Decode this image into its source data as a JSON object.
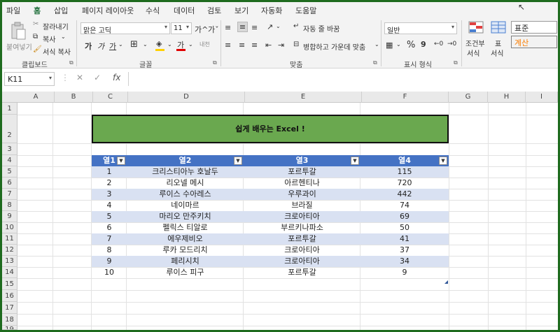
{
  "menu": {
    "tabs": [
      "파일",
      "홈",
      "삽입",
      "페이지 레이아웃",
      "수식",
      "데이터",
      "검토",
      "보기",
      "자동화",
      "도움말"
    ],
    "active_tab": "홈"
  },
  "ribbon": {
    "clipboard": {
      "paste": "붙여넣기",
      "cut": "잘라내기",
      "copy": "복사",
      "format_painter": "서식 복사",
      "label": "클립보드"
    },
    "font": {
      "family": "맑은 고딕",
      "size": "11",
      "grow": "가^",
      "shrink": "가ˇ",
      "bold": "가",
      "italic": "가",
      "underline": "가",
      "phonetic": "내천",
      "label": "글꼴"
    },
    "alignment": {
      "wrap_text": "자동 줄 바꿈",
      "merge_center": "병합하고 가운데 맞춤",
      "label": "맞춤"
    },
    "number": {
      "format": "일반",
      "percent": "%",
      "comma": "9",
      "label": "표시 형식"
    },
    "styles": {
      "conditional": "조건부",
      "conditional2": "서식",
      "table": "표",
      "table2": "서식",
      "normal": "표준",
      "calc": "계산"
    }
  },
  "formula_bar": {
    "name_box": "K11",
    "fx": "fx",
    "value": ""
  },
  "sheet": {
    "columns": [
      "A",
      "B",
      "C",
      "D",
      "E",
      "F",
      "G",
      "H",
      "I"
    ],
    "rows": [
      "1",
      "2",
      "3",
      "4",
      "5",
      "6",
      "7",
      "8",
      "9",
      "10",
      "11",
      "12",
      "13",
      "14",
      "15",
      "16",
      "17",
      "18",
      "19"
    ],
    "title": "쉽게 배우는 Excel !",
    "table": {
      "headers": [
        "열1",
        "열2",
        "열3",
        "열4"
      ],
      "rows": [
        [
          "1",
          "크리스티아누 호날두",
          "포르투갈",
          "115"
        ],
        [
          "2",
          "리오넬 메시",
          "아르헨티나",
          "720"
        ],
        [
          "3",
          "루이스 수아레스",
          "우루과이",
          "442"
        ],
        [
          "4",
          "네이마르",
          "브라질",
          "74"
        ],
        [
          "5",
          "마리오 만주키치",
          "크로아티아",
          "69"
        ],
        [
          "6",
          "펠릭스 티알로",
          "부르키나파소",
          "50"
        ],
        [
          "7",
          "에우제비오",
          "포르투갈",
          "41"
        ],
        [
          "8",
          "루카 모드리치",
          "크로아티아",
          "37"
        ],
        [
          "9",
          "페리시치",
          "크로아티아",
          "34"
        ],
        [
          "10",
          "루이스 피구",
          "포르투갈",
          "9"
        ]
      ]
    }
  },
  "colors": {
    "title_fill": "#6aa84f",
    "header_fill": "#4472c4",
    "band_fill": "#d9e1f2",
    "frame": "#1e6b1e"
  }
}
